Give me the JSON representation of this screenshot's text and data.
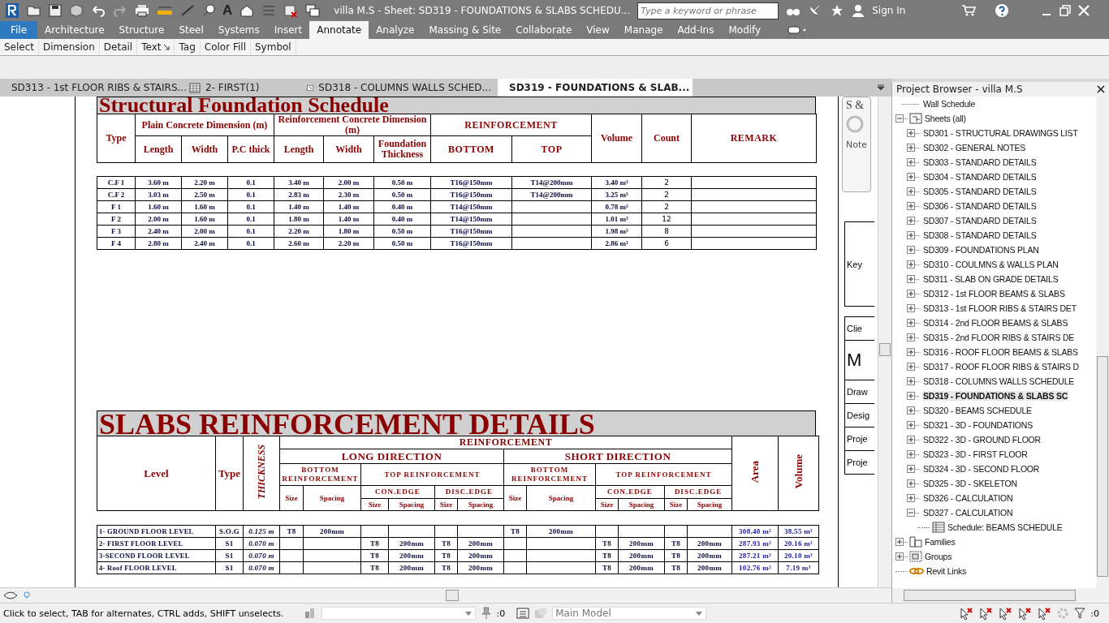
{
  "title_bar": {
    "title": "villa M.S - Sheet: SD319 - FOUNDATIONS & SLABS SCHEDU...",
    "text_tool_glyph": "A",
    "search": {
      "placeholder": "Type a keyword or phrase"
    },
    "sign_in": "Sign In"
  },
  "ribbon_tabs": [
    {
      "label": "File",
      "kind": "file",
      "selected": false
    },
    {
      "label": "Architecture",
      "kind": "tab",
      "selected": false
    },
    {
      "label": "Structure",
      "kind": "tab",
      "selected": false
    },
    {
      "label": "Steel",
      "kind": "tab",
      "selected": false
    },
    {
      "label": "Systems",
      "kind": "tab",
      "selected": false
    },
    {
      "label": "Insert",
      "kind": "tab",
      "selected": false
    },
    {
      "label": "Annotate",
      "kind": "tab",
      "selected": true
    },
    {
      "label": "Analyze",
      "kind": "tab",
      "selected": false
    },
    {
      "label": "Massing & Site",
      "kind": "tab",
      "selected": false
    },
    {
      "label": "Collaborate",
      "kind": "tab",
      "selected": false
    },
    {
      "label": "View",
      "kind": "tab",
      "selected": false
    },
    {
      "label": "Manage",
      "kind": "tab",
      "selected": false
    },
    {
      "label": "Add-Ins",
      "kind": "tab",
      "selected": false
    },
    {
      "label": "Modify",
      "kind": "tab",
      "selected": false
    }
  ],
  "panels": [
    {
      "label": "Select",
      "launcher": false
    },
    {
      "label": "Dimension",
      "launcher": false
    },
    {
      "label": "Detail",
      "launcher": false
    },
    {
      "label": "Text",
      "launcher": true
    },
    {
      "label": "Tag",
      "launcher": false
    },
    {
      "label": "Color Fill",
      "launcher": false
    },
    {
      "label": "Symbol",
      "launcher": false
    }
  ],
  "view_tabs": [
    {
      "label": "SD313 - 1st FLOOR RIBS & STAIRS...",
      "kind": "sheet",
      "selected": false
    },
    {
      "label": "2- FIRST(1)",
      "kind": "schedule",
      "selected": false
    },
    {
      "label": "SD318 - COLUMNS WALLS SCHED...",
      "kind": "sheet",
      "selected": false
    },
    {
      "label": "SD319 - FOUNDATIONS & SLAB...",
      "kind": "sheet",
      "selected": true
    }
  ],
  "navigation_bar": {
    "heading": "S &",
    "item": "Note"
  },
  "title_block": [
    {
      "label": "Key",
      "kind": "tall"
    },
    {
      "label": "Clie",
      "kind": "field"
    },
    {
      "label": "M",
      "kind": "large"
    },
    {
      "label": "Draw",
      "kind": "field"
    },
    {
      "label": "Desig",
      "kind": "field"
    },
    {
      "label": "Proje",
      "kind": "field"
    },
    {
      "label": "Proje",
      "kind": "field"
    }
  ],
  "foundation_schedule": {
    "title": "Structural Foundation Schedule",
    "headers": {
      "type": "Type",
      "plain_concrete": "Plain Concrete Dimension (m)",
      "pc_length": "Length",
      "pc_width": "Width",
      "pc_thick": "P.C thick",
      "reinforcement_concrete": "Reinforcement Concrete Dimension (m)",
      "rc_length": "Length",
      "rc_width": "Width",
      "foundation_thickness": "Foundation Thickness",
      "reinforcement": "REINFORCEMENT",
      "bottom": "BOTTOM",
      "top": "TOP",
      "volume": "Volume",
      "count": "Count",
      "remark": "REMARK"
    },
    "rows": [
      {
        "type": "C.F 1",
        "pc_length": "3.60 m",
        "pc_width": "2.20 m",
        "pc_thick": "0.1",
        "rc_length": "3.40 m",
        "rc_width": "2.00 m",
        "thickness": "0.50 m",
        "bottom": "T16@150mm",
        "top": "T14@200mm",
        "volume": "3.40 m³",
        "count": "2"
      },
      {
        "type": "C.F 2",
        "pc_length": "3.03 m",
        "pc_width": "2.50 m",
        "pc_thick": "0.1",
        "rc_length": "2.83 m",
        "rc_width": "2.30 m",
        "thickness": "0.50 m",
        "bottom": "T16@150mm",
        "top": "T14@200mm",
        "volume": "3.25 m³",
        "count": "2"
      },
      {
        "type": "F 1",
        "pc_length": "1.60 m",
        "pc_width": "1.60 m",
        "pc_thick": "0.1",
        "rc_length": "1.40 m",
        "rc_width": "1.40 m",
        "thickness": "0.40 m",
        "bottom": "T14@150mm",
        "volume": "0.78 m³",
        "count": "2"
      },
      {
        "type": "F 2",
        "pc_length": "2.00 m",
        "pc_width": "1.60 m",
        "pc_thick": "0.1",
        "rc_length": "1.80 m",
        "rc_width": "1.40 m",
        "thickness": "0.40 m",
        "bottom": "T14@150mm",
        "volume": "1.01 m³",
        "count": "12"
      },
      {
        "type": "F 3",
        "pc_length": "2.40 m",
        "pc_width": "2.00 m",
        "pc_thick": "0.1",
        "rc_length": "2.20 m",
        "rc_width": "1.80 m",
        "thickness": "0.50 m",
        "bottom": "T16@150mm",
        "volume": "1.98 m³",
        "count": "8"
      },
      {
        "type": "F 4",
        "pc_length": "2.80 m",
        "pc_width": "2.40 m",
        "pc_thick": "0.1",
        "rc_length": "2.60 m",
        "rc_width": "2.20 m",
        "thickness": "0.50 m",
        "bottom": "T16@150mm",
        "volume": "2.86 m³",
        "count": "6"
      }
    ]
  },
  "slabs_schedule": {
    "title": "SLABS REINFORCEMENT DETAILS",
    "headers": {
      "level": "Level",
      "type": "Type",
      "thickness": "THICKNESS",
      "reinforcement": "REINFORCEMENT",
      "area": "Area",
      "volume": "Volume",
      "directions": [
        {
          "name": "LONG DIRECTION",
          "bottom": "BOTTOM REINFORCEMENT",
          "top": "TOP REINFORCEMENT",
          "size": "Size",
          "spacing": "Spacing",
          "edges": [
            {
              "name": "CON.EDGE",
              "size": "Size",
              "spacing": "Spacing"
            },
            {
              "name": "DISC.EDGE",
              "size": "Size",
              "spacing": "Spacing"
            }
          ]
        },
        {
          "name": "SHORT DIRECTION",
          "bottom": "BOTTOM REINFORCEMENT",
          "top": "TOP REINFORCEMENT",
          "size": "Size",
          "spacing": "Spacing",
          "edges": [
            {
              "name": "CON.EDGE",
              "size": "Size",
              "spacing": "Spacing"
            },
            {
              "name": "DISC.EDGE",
              "size": "Size",
              "spacing": "Spacing"
            }
          ]
        }
      ]
    },
    "rows": [
      {
        "level": "1- GROUND FLOOR LEVEL",
        "type": "S.O.G",
        "thickness": "0.125 m",
        "long_bottom_size": "T8",
        "long_bottom_spacing": "200mm",
        "short_bottom_size": "T8",
        "short_bottom_spacing": "200mm",
        "area": "308.40 m²",
        "volume": "38.55 m³"
      },
      {
        "level": "2- FIRST FLOOR LEVEL",
        "type": "S1",
        "thickness": "0.070 m",
        "long_con_size": "T8",
        "long_con_spacing": "200mm",
        "long_disc_size": "T8",
        "long_disc_spacing": "200mm",
        "short_con_size": "T8",
        "short_con_spacing": "200mm",
        "short_disc_size": "T8",
        "short_disc_spacing": "200mm",
        "area": "287.93 m²",
        "volume": "20.16 m³"
      },
      {
        "level": "3-SECOND FLOOR LEVEL",
        "type": "S1",
        "thickness": "0.070 m",
        "long_con_size": "T8",
        "long_con_spacing": "200mm",
        "long_disc_size": "T8",
        "long_disc_spacing": "200mm",
        "short_con_size": "T8",
        "short_con_spacing": "200mm",
        "short_disc_size": "T8",
        "short_disc_spacing": "200mm",
        "area": "287.21 m²",
        "volume": "20.10 m³"
      },
      {
        "level": "4- Roof FLOOR LEVEL",
        "type": "S1",
        "thickness": "0.070 m",
        "long_con_size": "T8",
        "long_con_spacing": "200mm",
        "long_disc_size": "T8",
        "long_disc_spacing": "200mm",
        "short_con_size": "T8",
        "short_con_spacing": "200mm",
        "short_disc_size": "T8",
        "short_disc_spacing": "200mm",
        "area": "102.76 m²",
        "volume": "7.19 m³"
      }
    ]
  },
  "browser": {
    "title": "Project Browser - villa M.S",
    "items": [
      {
        "label": "Wall Schedule",
        "kind": "view",
        "selected": false
      },
      {
        "label": "Sheets (all)",
        "kind": "sheets",
        "expanded": true,
        "selected": false,
        "children": [
          {
            "label": "SD301 - STRUCTURAL DRAWINGS LIST",
            "kind": "node",
            "expanded": false,
            "selected": false
          },
          {
            "label": "SD302 - GENERAL NOTES",
            "kind": "node",
            "expanded": false,
            "selected": false
          },
          {
            "label": "SD303 - STANDARD DETAILS",
            "kind": "node",
            "expanded": false,
            "selected": false
          },
          {
            "label": "SD304 - STANDARD DETAILS",
            "kind": "node",
            "expanded": false,
            "selected": false
          },
          {
            "label": "SD305 - STANDARD DETAILS",
            "kind": "node",
            "expanded": false,
            "selected": false
          },
          {
            "label": "SD306 - STANDARD DETAILS",
            "kind": "node",
            "expanded": false,
            "selected": false
          },
          {
            "label": "SD307 - STANDARD DETAILS",
            "kind": "node",
            "expanded": false,
            "selected": false
          },
          {
            "label": "SD308 - STANDARD DETAILS",
            "kind": "node",
            "expanded": false,
            "selected": false
          },
          {
            "label": "SD309 - FOUNDATIONS PLAN",
            "kind": "node",
            "expanded": false,
            "selected": false
          },
          {
            "label": "SD310 - COULMNS & WALLS PLAN",
            "kind": "node",
            "expanded": false,
            "selected": false
          },
          {
            "label": "SD311 - SLAB ON GRADE DETAILS",
            "kind": "node",
            "expanded": false,
            "selected": false
          },
          {
            "label": "SD312 - 1st FLOOR BEAMS & SLABS",
            "kind": "node",
            "expanded": false,
            "selected": false
          },
          {
            "label": "SD313 - 1st FLOOR RIBS & STAIRS DET",
            "kind": "node",
            "expanded": false,
            "selected": false
          },
          {
            "label": "SD314 - 2nd FLOOR BEAMS & SLABS",
            "kind": "node",
            "expanded": false,
            "selected": false
          },
          {
            "label": "SD315 - 2nd FLOOR RIBS & STAIRS DE",
            "kind": "node",
            "expanded": false,
            "selected": false
          },
          {
            "label": "SD316 - ROOF FLOOR BEAMS & SLABS",
            "kind": "node",
            "expanded": false,
            "selected": false
          },
          {
            "label": "SD317 - ROOF FLOOR RIBS & STAIRS D",
            "kind": "node",
            "expanded": false,
            "selected": false
          },
          {
            "label": "SD318 - COLUMNS WALLS SCHEDULE",
            "kind": "node",
            "expanded": false,
            "selected": false
          },
          {
            "label": "SD319 - FOUNDATIONS & SLABS SC",
            "kind": "node",
            "expanded": false,
            "selected": true
          },
          {
            "label": "SD320 - BEAMS SCHEDULE",
            "kind": "node",
            "expanded": false,
            "selected": false
          },
          {
            "label": "SD321 - 3D - FOUNDATIONS",
            "kind": "node",
            "expanded": false,
            "selected": false
          },
          {
            "label": "SD322 - 3D - GROUND FLOOR",
            "kind": "node",
            "expanded": false,
            "selected": false
          },
          {
            "label": "SD323 - 3D - FIRST FLOOR",
            "kind": "node",
            "expanded": false,
            "selected": false
          },
          {
            "label": "SD324 - 3D - SECOND FLOOR",
            "kind": "node",
            "expanded": false,
            "selected": false
          },
          {
            "label": "SD325 - 3D - SKELETON",
            "kind": "node",
            "expanded": false,
            "selected": false
          },
          {
            "label": "SD326 - CALCULATION",
            "kind": "node",
            "expanded": false,
            "selected": false
          },
          {
            "label": "SD327 - CALCULATION",
            "kind": "node",
            "expanded": true,
            "selected": false,
            "children": [
              {
                "label": "Schedule: BEAMS SCHEDULE",
                "kind": "schedule",
                "selected": false
              }
            ]
          }
        ]
      },
      {
        "label": "Families",
        "kind": "families",
        "expanded": false,
        "selected": false
      },
      {
        "label": "Groups",
        "kind": "groups",
        "expanded": false,
        "selected": false
      },
      {
        "label": "Revit Links",
        "kind": "links",
        "selected": false
      }
    ]
  },
  "status_bar": {
    "hint": "Click to select, TAB for alternates, CTRL adds, SHIFT unselects.",
    "worksets_count": ":0",
    "model": "Main Model",
    "filter_count": ":0"
  }
}
